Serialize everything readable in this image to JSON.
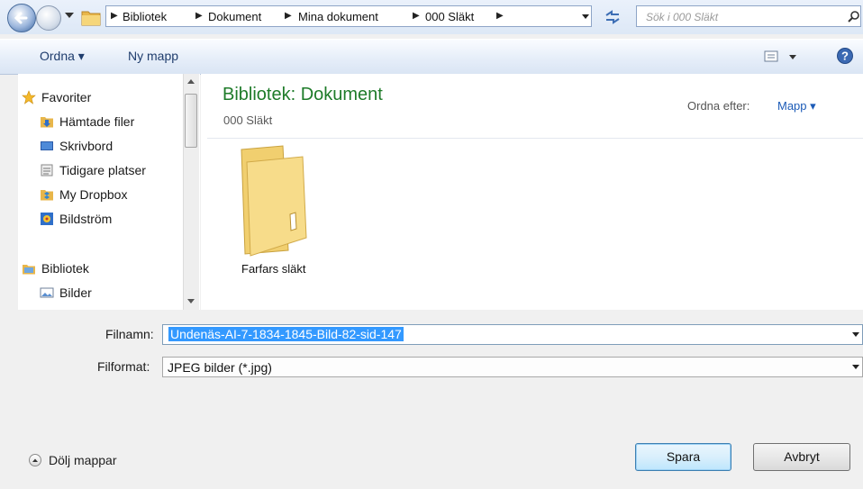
{
  "address": {
    "crumbs": [
      "Bibliotek",
      "Dokument",
      "Mina dokument",
      "000 Släkt"
    ],
    "search_placeholder": "Sök i 000 Släkt"
  },
  "toolbar": {
    "organize_label": "Ordna ▾",
    "new_folder_label": "Ny mapp"
  },
  "sidebar": {
    "favorites_label": "Favoriter",
    "favorites": [
      "Hämtade filer",
      "Skrivbord",
      "Tidigare platser",
      "My Dropbox",
      "Bildström"
    ],
    "library_label": "Bibliotek",
    "libraries": [
      "Bilder"
    ]
  },
  "content": {
    "title": "Bibliotek: Dokument",
    "subtitle": "000 Släkt",
    "sort_label": "Ordna efter:",
    "sort_value": "Mapp ▾",
    "folders": [
      {
        "name": "Farfars släkt"
      }
    ]
  },
  "form": {
    "filename_label": "Filnamn:",
    "filename_value": "Undenäs-AI-7-1834-1845-Bild-82-sid-147",
    "filetype_label": "Filformat:",
    "filetype_value": "JPEG bilder (*.jpg)"
  },
  "buttons": {
    "save": "Spara",
    "cancel": "Avbryt",
    "hide_folders": "Dölj mappar"
  },
  "colors": {
    "library_title": "#1e7b29",
    "link_blue": "#1c5bb7",
    "selection": "#3399ff"
  }
}
